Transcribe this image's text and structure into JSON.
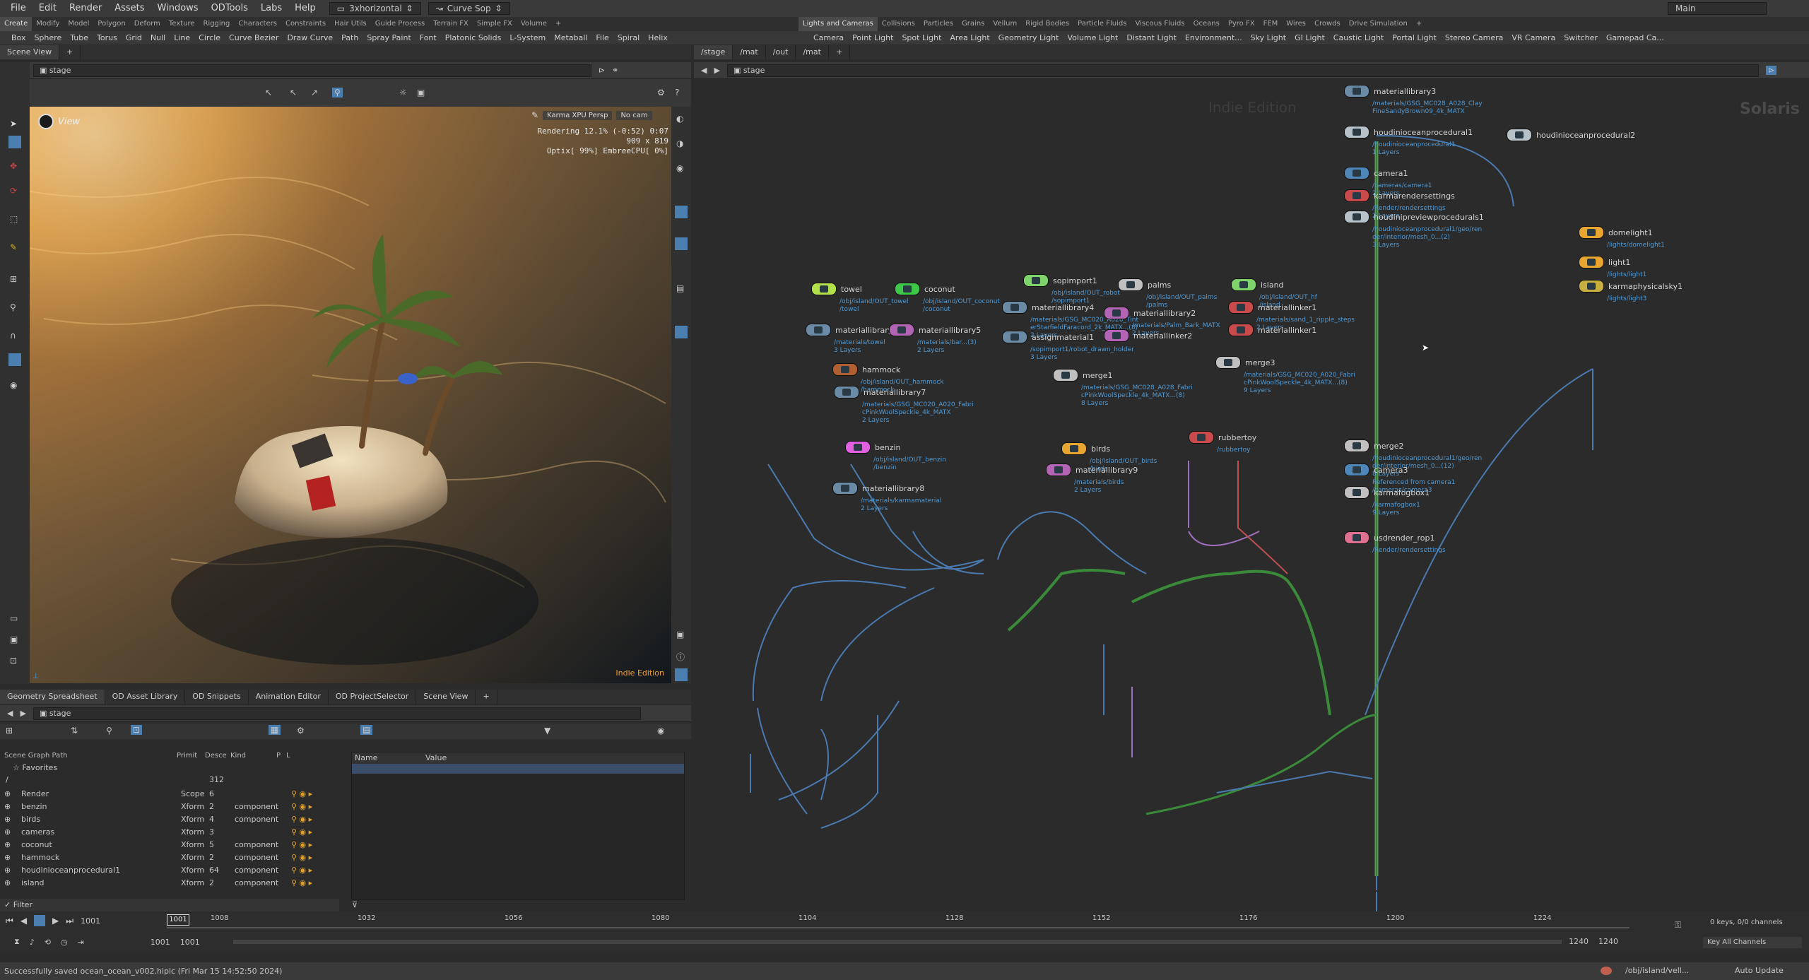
{
  "menubar": {
    "items": [
      "File",
      "Edit",
      "Render",
      "Assets",
      "Windows",
      "ODTools",
      "Labs",
      "Help"
    ],
    "desktop": "3xhorizontal",
    "tool": "Curve Sop",
    "workspace": "Main"
  },
  "shelf_left": [
    "Create",
    "Modify",
    "Model",
    "Polygon",
    "Deform",
    "Texture",
    "Rigging",
    "Characters",
    "Constraints",
    "Hair Utils",
    "Guide Process",
    "Terrain FX",
    "Simple FX",
    "Volume"
  ],
  "shelf_right": [
    "Lights and Cameras",
    "Collisions",
    "Particles",
    "Grains",
    "Vellum",
    "Rigid Bodies",
    "Particle Fluids",
    "Viscous Fluids",
    "Oceans",
    "Pyro FX",
    "FEM",
    "Wires",
    "Crowds",
    "Drive Simulation"
  ],
  "tools_left": [
    "Box",
    "Sphere",
    "Tube",
    "Torus",
    "Grid",
    "Null",
    "Line",
    "Circle",
    "Curve Bezier",
    "Draw Curve",
    "Path",
    "Spray Paint",
    "Font",
    "Platonic Solids",
    "L-System",
    "Metaball",
    "File",
    "Spiral",
    "Helix"
  ],
  "tools_right": [
    "Camera",
    "Point Light",
    "Spot Light",
    "Area Light",
    "Geometry Light",
    "Volume Light",
    "Distant Light",
    "Environment...",
    "Sky Light",
    "GI Light",
    "Caustic Light",
    "Portal Light",
    "Stereo Camera",
    "VR Camera",
    "Switcher",
    "Gamepad Ca..."
  ],
  "left_pane": {
    "tab": "Scene View",
    "path": "stage"
  },
  "right_pane": {
    "tabs": [
      "/stage",
      "/mat",
      "/out",
      "/mat"
    ],
    "path": "stage",
    "watermark": "Indie Edition",
    "context": "Solaris"
  },
  "viewport": {
    "view_label": "View",
    "renderer": "Karma XPU Persp",
    "camera": "No cam",
    "stats1": "Rendering  12.1%  (-0:52)  0:07",
    "stats2": "909 x 819",
    "stats3": "Optix[ 99%] EmbreeCPU[  0%]",
    "edition": "Indie Edition"
  },
  "bottom_tabs": [
    "Geometry Spreadsheet",
    "OD Asset Library",
    "OD Snippets",
    "Animation Editor",
    "OD ProjectSelector",
    "Scene View"
  ],
  "sg": {
    "headers": [
      "Scene Graph Path",
      "Primit",
      "Desce",
      "Kind",
      "P",
      "L"
    ],
    "favorites": "Favorites",
    "root": "/",
    "root_count": "312",
    "rows": [
      {
        "name": "Render",
        "prim": "Scope",
        "desc": "6",
        "kind": ""
      },
      {
        "name": "benzin",
        "prim": "Xform",
        "desc": "2",
        "kind": "component"
      },
      {
        "name": "birds",
        "prim": "Xform",
        "desc": "4",
        "kind": "component"
      },
      {
        "name": "cameras",
        "prim": "Xform",
        "desc": "3",
        "kind": ""
      },
      {
        "name": "coconut",
        "prim": "Xform",
        "desc": "5",
        "kind": "component"
      },
      {
        "name": "hammock",
        "prim": "Xform",
        "desc": "2",
        "kind": "component"
      },
      {
        "name": "houdinioceanprocedural1",
        "prim": "Xform",
        "desc": "64",
        "kind": "component"
      },
      {
        "name": "island",
        "prim": "Xform",
        "desc": "2",
        "kind": "component"
      }
    ],
    "filter": "Filter",
    "props_headers": [
      "Name",
      "Value"
    ]
  },
  "nodes": [
    {
      "name": "materiallibrary3",
      "sub": "/materials/GSG_MC028_A028_Clay\nFineSandyBrown09_4k_MATX",
      "color": "#6a8aa6"
    },
    {
      "name": "houdinioceanprocedural1",
      "sub": "/houdinioceanprocedural1\n1 Layers",
      "color": "#b7c2c8"
    },
    {
      "name": "houdinioceanprocedural2",
      "sub": "",
      "color": "#b7c2c8"
    },
    {
      "name": "camera1",
      "sub": "/cameras/camera1\n2 Layers",
      "color": "#4e86b8"
    },
    {
      "name": "karmarendersettings",
      "sub": "/Render/rendersettings\n2 Layers",
      "color": "#c84a4a"
    },
    {
      "name": "houdinipreviewprocedurals1",
      "sub": "/houdinioceanprocedural1/geo/ren\nder/interior/mesh_0...(2)\n3 Layers",
      "color": "#b7c2c8"
    },
    {
      "name": "domelight1",
      "sub": "/lights/domelight1",
      "color": "#e8a530"
    },
    {
      "name": "light1",
      "sub": "/lights/light1",
      "color": "#e8a530"
    },
    {
      "name": "karmaphysicalsky1",
      "sub": "/lights/light3",
      "color": "#c8b040"
    },
    {
      "name": "sopimport1",
      "sub": "/obj/island/OUT_robot\n/sopimport1",
      "color": "#7ed36a"
    },
    {
      "name": "palms",
      "sub": "/obj/island/OUT_palms\n/palms",
      "color": "#c0c0c0"
    },
    {
      "name": "island",
      "sub": "/obj/island/OUT_hf\n/island",
      "color": "#7ed36a"
    },
    {
      "name": "towel",
      "sub": "/obj/island/OUT_towel\n/towel",
      "color": "#b2e04a"
    },
    {
      "name": "coconut",
      "sub": "/obj/island/OUT_coconut\n/coconut",
      "color": "#3ec84a"
    },
    {
      "name": "materiallibrary4",
      "sub": "/materials/GSG_MC020_A020_Tint\nerStarfieldFaracord_2k_MATX...(8)\n2 Layers",
      "color": "#6a8aa6"
    },
    {
      "name": "materiallibrary2",
      "sub": "/materials/Palm_Bark_MATX\n2 Layers",
      "color": "#b464b4"
    },
    {
      "name": "materiallinker1",
      "sub": "/materials/sand_1_ripple_steps\n2 Layers",
      "color": "#c84a4a"
    },
    {
      "name": "materiallibrary",
      "sub": "/materials/towel\n3 Layers",
      "color": "#6a8aa6"
    },
    {
      "name": "materiallibrary5",
      "sub": "/materials/bar...(3)\n2 Layers",
      "color": "#b464b4"
    },
    {
      "name": "assignmaterial1",
      "sub": "/sopimport1/robot_drawn_holder\n3 Layers",
      "color": "#6a8aa6"
    },
    {
      "name": "materiallinker2",
      "sub": "",
      "color": "#b464b4"
    },
    {
      "name": "materiallinker1b",
      "sub": "",
      "color": "#c84a4a"
    },
    {
      "name": "merge3",
      "sub": "/materials/GSG_MC020_A020_Fabri\ncPinkWoolSpeckle_4k_MATX...(8)\n9 Layers",
      "color": "#c0c0c0"
    },
    {
      "name": "hammock",
      "sub": "/obj/island/OUT_hammock\n/hammock",
      "color": "#b06030"
    },
    {
      "name": "merge1",
      "sub": "/materials/GSG_MC028_A028_Fabri\ncPinkWoolSpeckle_4k_MATX...(8)\n8 Layers",
      "color": "#c0c0c0"
    },
    {
      "name": "materiallibrary7",
      "sub": "/materials/GSG_MC020_A020_Fabri\ncPinkWoolSpeckle_4k_MATX\n2 Layers",
      "color": "#6a8aa6"
    },
    {
      "name": "rubbertoy",
      "sub": "/rubbertoy",
      "color": "#c84a4a"
    },
    {
      "name": "benzin",
      "sub": "/obj/island/OUT_benzin\n/benzin",
      "color": "#e060e0"
    },
    {
      "name": "birds",
      "sub": "/obj/island/OUT_birds\n/birds",
      "color": "#e8a530"
    },
    {
      "name": "merge2",
      "sub": "/houdinioceanprocedural1/geo/ren\nder/interior/mesh_0...(12)\n8 Layers",
      "color": "#c0c0c0"
    },
    {
      "name": "materiallibrary9",
      "sub": "/materials/birds\n2 Layers",
      "color": "#b464b4"
    },
    {
      "name": "camera3",
      "sub": "Referenced from camera1\n/cameras/camera3",
      "color": "#4e86b8"
    },
    {
      "name": "materiallibrary8",
      "sub": "/materials/karmamaterial\n2 Layers",
      "color": "#6a8aa6"
    },
    {
      "name": "karmafogbox1",
      "sub": "/karmafogbox1\n9 Layers",
      "color": "#c0c0c0"
    },
    {
      "name": "usdrender_rop1",
      "sub": "/Render/rendersettings",
      "color": "#e07090"
    }
  ],
  "timeline": {
    "frame": "1001",
    "start": "1001",
    "start2": "1001",
    "end": "1240",
    "end2": "1240",
    "ticks": [
      "1008",
      "1032",
      "1056",
      "1080",
      "1104",
      "1128",
      "1152",
      "1176",
      "1200",
      "1224"
    ],
    "keys": "0 keys, 0/0 channels",
    "key_all": "Key All Channels"
  },
  "status": {
    "message": "Successfully saved ocean_ocean_v002.hiplc (Fri Mar 15 14:52:50 2024)",
    "path": "/obj/island/vell...",
    "update": "Auto Update"
  }
}
